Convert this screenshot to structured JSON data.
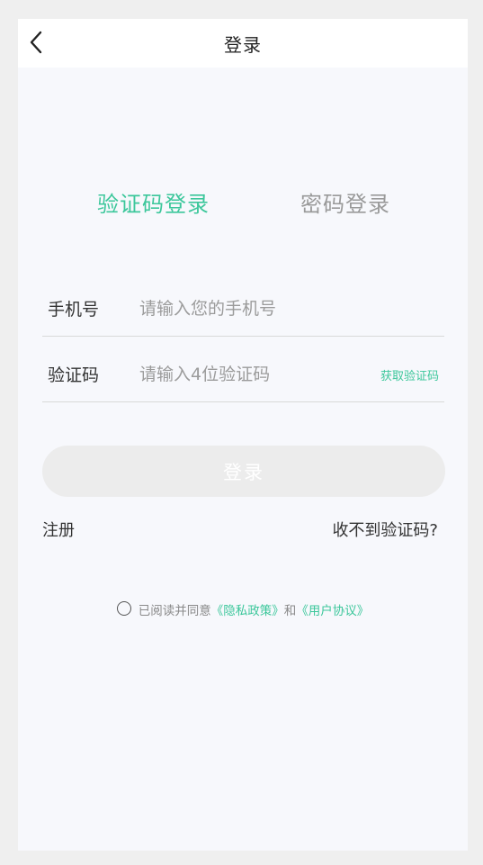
{
  "header": {
    "title": "登录",
    "back_icon": "chevron-left-icon"
  },
  "tabs": [
    {
      "label": "验证码登录",
      "active": true
    },
    {
      "label": "密码登录",
      "active": false
    }
  ],
  "form": {
    "phone": {
      "label": "手机号",
      "placeholder": "请输入您的手机号",
      "value": ""
    },
    "code": {
      "label": "验证码",
      "placeholder": "请输入4位验证码",
      "value": "",
      "get_code_label": "获取验证码"
    },
    "submit_label": "登录"
  },
  "links": {
    "register": "注册",
    "no_code": "收不到验证码?"
  },
  "agreement": {
    "checked": false,
    "prefix": "已阅读并同意",
    "privacy_link": "《隐私政策》",
    "conjunction": "和",
    "user_link": "《用户协议》"
  },
  "colors": {
    "accent": "#3cc79b",
    "background": "#f7f8fc",
    "button_disabled": "#ececec",
    "inactive_tab": "#9a9a9a"
  }
}
